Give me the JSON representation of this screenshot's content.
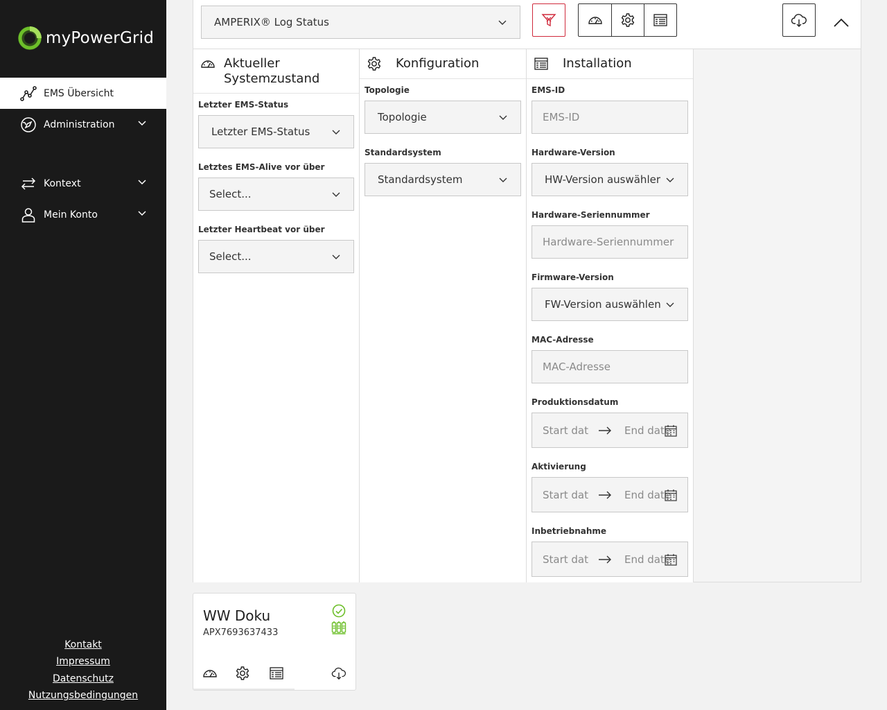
{
  "brand": {
    "name": "myPowerGrid",
    "accent": "#6dbf2a"
  },
  "sidebar": {
    "items": [
      {
        "label": "EMS Übersicht",
        "icon": "chart-line-icon",
        "active": true
      },
      {
        "label": "Administration",
        "icon": "compass-icon",
        "expandable": true
      },
      {
        "label": "Kontext",
        "icon": "swap-arrows-icon",
        "expandable": true
      },
      {
        "label": "Mein Konto",
        "icon": "user-icon",
        "expandable": true
      }
    ],
    "footer_links": [
      "Kontakt",
      "Impressum",
      "Datenschutz",
      "Nutzungsbedingungen"
    ]
  },
  "toolbar": {
    "log_select_value": "AMPERIX® Log Status",
    "filter_icon": "filter-clear-icon",
    "group_icons": [
      "gauge-icon",
      "gear-icon",
      "table-icon"
    ],
    "download_icon": "cloud-download-icon",
    "collapse_icon": "chevron-up-icon"
  },
  "panel": {
    "system": {
      "title": "Aktueller Systemzustand",
      "fields": [
        {
          "label": "Letzter EMS-Status",
          "value": "Letzter EMS-Status"
        },
        {
          "label": "Letztes EMS-Alive vor über",
          "value": "Select..."
        },
        {
          "label": "Letzter Heartbeat vor über",
          "value": "Select..."
        }
      ]
    },
    "config": {
      "title": "Konfiguration",
      "fields": [
        {
          "label": "Topologie",
          "value": "Topologie"
        },
        {
          "label": "Standardsystem",
          "value": "Standardsystem"
        }
      ]
    },
    "installation": {
      "title": "Installation",
      "ems_id": {
        "label": "EMS-ID",
        "placeholder": "EMS-ID"
      },
      "hw_version": {
        "label": "Hardware-Version",
        "value": "HW-Version auswähler"
      },
      "hw_serial": {
        "label": "Hardware-Seriennummer",
        "placeholder": "Hardware-Seriennummer"
      },
      "fw_version": {
        "label": "Firmware-Version",
        "value": "FW-Version auswählen"
      },
      "mac": {
        "label": "MAC-Adresse",
        "placeholder": "MAC-Adresse"
      },
      "date_ranges": [
        {
          "label": "Produktionsdatum",
          "start": "Start dat",
          "end": "End date"
        },
        {
          "label": "Aktivierung",
          "start": "Start dat",
          "end": "End date"
        },
        {
          "label": "Inbetriebnahme",
          "start": "Start dat",
          "end": "End date"
        }
      ]
    }
  },
  "card": {
    "title": "WW Doku",
    "serial": "APX7693637433",
    "status_color": "#6dbf2a"
  }
}
